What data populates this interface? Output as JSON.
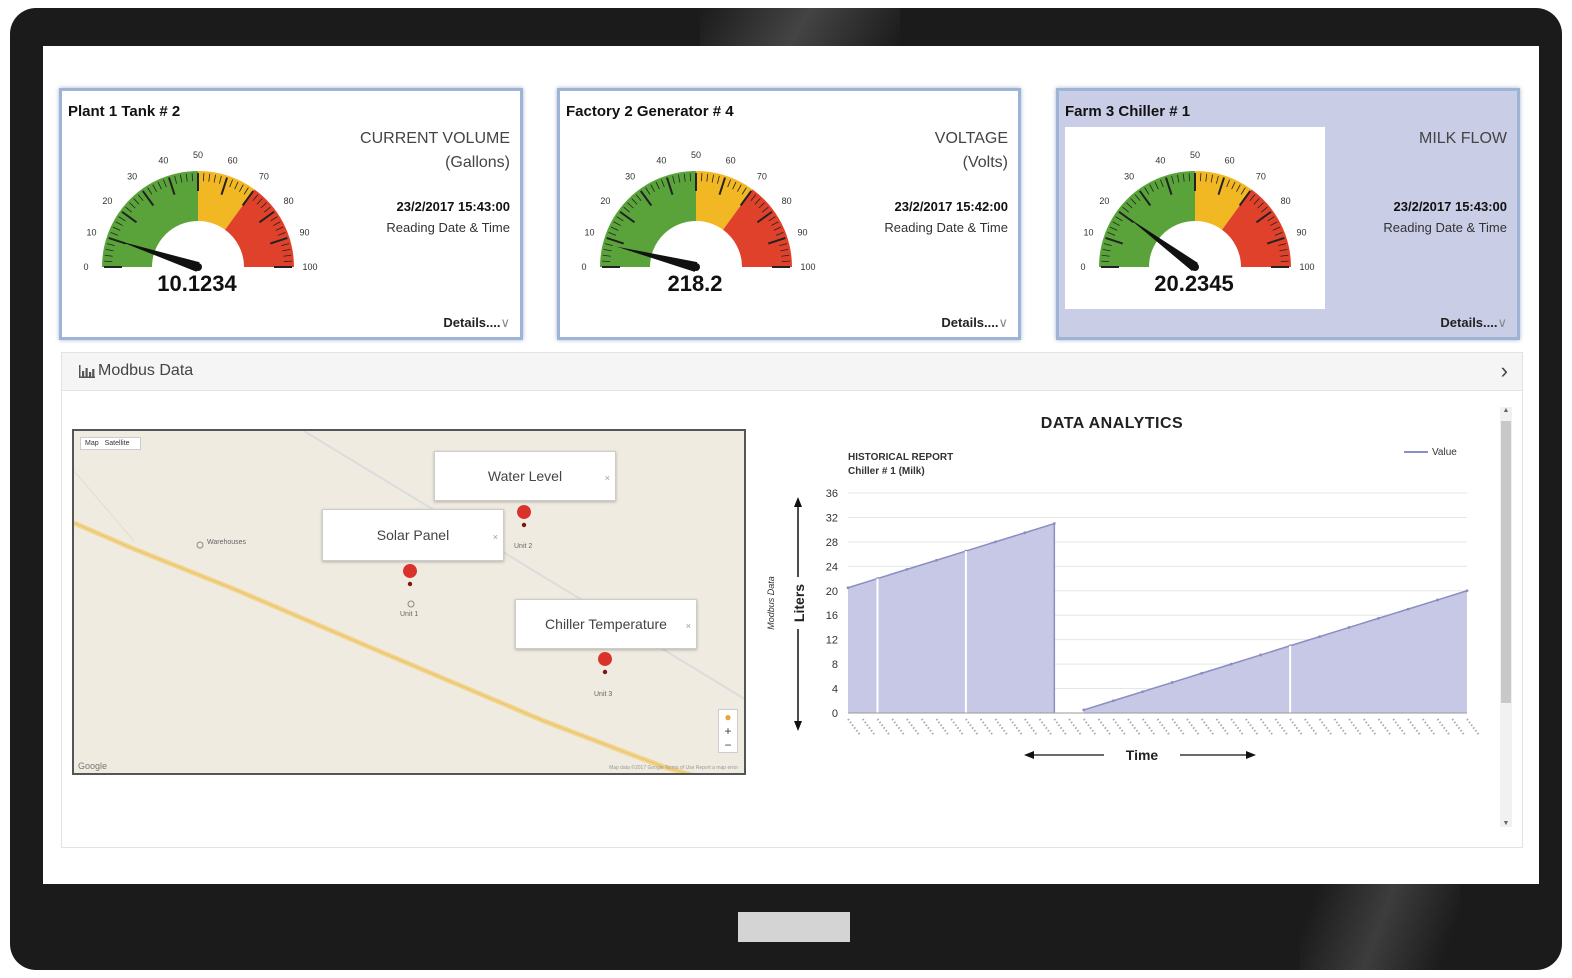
{
  "cards": [
    {
      "title": "Plant 1 Tank # 2",
      "metric": "CURRENT VOLUME",
      "unit": "(Gallons)",
      "datetime": "23/2/2017 15:43:00",
      "reading_label": "Reading Date & Time",
      "value": "10.1234",
      "needle": 10.1234,
      "details": "Details....",
      "highlighted": false
    },
    {
      "title": "Factory 2 Generator # 4",
      "metric": "VOLTAGE",
      "unit": "(Volts)",
      "datetime": "23/2/2017 15:42:00",
      "reading_label": "Reading Date & Time",
      "value": "218.2",
      "needle": 8,
      "details": "Details....",
      "highlighted": false
    },
    {
      "title": "Farm 3 Chiller # 1",
      "metric": "MILK FLOW",
      "unit": "",
      "datetime": "23/2/2017 15:43:00",
      "reading_label": "Reading Date & Time",
      "value": "20.2345",
      "needle": 20.2345,
      "details": "Details....",
      "highlighted": true
    }
  ],
  "gauge": {
    "ticks": [
      "0",
      "10",
      "20",
      "30",
      "40",
      "50",
      "60",
      "70",
      "80",
      "90",
      "100"
    ],
    "bands": [
      {
        "from": 0,
        "to": 50,
        "color": "#5aa33a"
      },
      {
        "from": 50,
        "to": 70,
        "color": "#f2b824"
      },
      {
        "from": 70,
        "to": 100,
        "color": "#e0412a"
      }
    ]
  },
  "panel": {
    "title": "Modbus Data"
  },
  "map": {
    "toggle": [
      "Map",
      "Satellite"
    ],
    "poi": "Warehouses",
    "infoboxes": [
      "Water Level",
      "Solar Panel",
      "Chiller Temperature"
    ],
    "units": [
      "Unit 2",
      "Unit 1",
      "Unit 3"
    ],
    "google": "Google",
    "terms": "Map data ©2017 Google   Terms of Use   Report a map error",
    "zoom_in": "+",
    "zoom_out": "−"
  },
  "analytics": {
    "title": "DATA  ANALYTICS",
    "report_title": "HISTORICAL REPORT",
    "report_subtitle": "Chiller # 1 (Milk)"
  },
  "chart_data": {
    "type": "area",
    "title": "DATA  ANALYTICS",
    "subtitle": "HISTORICAL REPORT Chiller # 1 (Milk)",
    "xlabel": "Time",
    "ylabel": "Liters",
    "ylabel_secondary": "Modbus Data",
    "ylim": [
      0,
      36
    ],
    "yticks": [
      0,
      4,
      8,
      12,
      16,
      20,
      24,
      28,
      32,
      36
    ],
    "grid": true,
    "legend_position": "top-right",
    "color": "#8a8ec2",
    "fill": "#c6c8e6",
    "series": [
      {
        "name": "Value",
        "values": [
          20.5,
          22,
          23.5,
          25,
          26.5,
          28,
          29.5,
          31,
          0.5,
          2,
          3.5,
          5,
          6.5,
          8,
          9.5,
          11,
          12.5,
          14,
          15.5,
          17,
          18.5,
          20
        ]
      }
    ]
  }
}
